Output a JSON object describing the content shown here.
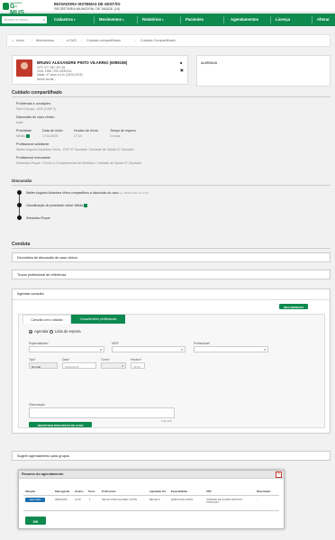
{
  "header": {
    "logo_small": "Inovadora",
    "logo_text": "G-MUS",
    "org_name": "INOVADORA SISTEMAS DE GESTÃO",
    "org_sub": "SECRETARIA MUNICIPAL DE SAÚDE (10)"
  },
  "nav": {
    "search_placeholder": "Buscar no menu...",
    "items": [
      "Cadastros",
      "Movimentos",
      "Relatórios",
      "Pacientes",
      "Agendamentos",
      "Licença",
      "Alterar"
    ]
  },
  "breadcrumb": [
    "Início",
    "Movimentos",
    "e-SUS",
    "Cuidado compartilhado",
    "Cuidado Compartilhado"
  ],
  "patient": {
    "name": "BRUNO ALEXANDRE PINTO VILARINO (6098186)",
    "lines": [
      "CPF: 077.987.207-51",
      "CNS: 1395 7031 0539 611",
      "Idade: 47 anos e 6 m (20/01/1978)",
      "Nome social: -"
    ],
    "alerts_label": "ALERGIAS"
  },
  "cuidado": {
    "title": "Cuidado compartilhado",
    "problem_label": "Problemas e condições",
    "problem_value": "Sem Doença - AH1 (CIAP 2)",
    "discussion_label": "Discussão de caso clínico",
    "discussion_value": "teste",
    "priority_label": "Prioridade",
    "priority_value": "Média",
    "start_date_label": "Data de início",
    "start_date_value": "17/11/2025",
    "start_time_label": "Horário de início",
    "start_time_value": "17:44",
    "wait_label": "Tempo de espera",
    "wait_value": "0 horas",
    "requester_label": "Profissional solicitante",
    "requester_value": "Walter Augusto Alcantara Vieira - ESF 07 Saudade / Unidade de Saúde 07 Saudade",
    "executor_label": "Profissional executante",
    "executor_value": "Sebastiao Roque / Clínico e Complementar de Medicina / Unidade de Saúde 07 Saudade"
  },
  "discussao": {
    "title": "Discussão",
    "entry1_text": "Walter Augusto Alcantara Vieira compartilhou a discussão do caso",
    "entry1_date": "em 08/06/2025 às 10:51",
    "entry2_text": "Classificação de prioridade inicial: Média",
    "entry3_text": "Sebastiao Roque"
  },
  "conduta": {
    "title": "Conduta",
    "option1": "Devolutiva de discussão de caso clínico",
    "option2": "Trocar profissional de referência",
    "agendar_title": "Agendar consulta",
    "add_button": "INCLUIR/NOVO",
    "tab1": "Consulta com o cidadão",
    "tab2": "Consulta entre profissionais",
    "radio_agendar": "Agendar",
    "radio_lista": "Lista de espera",
    "especialidade_label": "Especialidade",
    "ubs_label": "UBS",
    "profissional_label": "Profissional",
    "tipo_label": "Tipo",
    "tipo_value": "Normal",
    "data_label": "Data",
    "data_value": "05/06/2025",
    "turno_label": "Turno",
    "horario_label": "Horário",
    "horario_value": "08:00",
    "obs_label": "Observação",
    "obs_counter": "0 de 200",
    "register_button": "REGISTRAR DISCUSSÃO DE CASO",
    "sugerir": "Sugerir agendamento para grupos"
  },
  "modal": {
    "title": "Resumo do agendamento",
    "close": "×",
    "headers": [
      "Situação",
      "Data agenda",
      "Horário",
      "Turno",
      "Profissional",
      "Agendado Por",
      "Especialidade",
      "UPS",
      "Observação"
    ],
    "row": {
      "status": "Agendado",
      "date": "08/06/2025",
      "time": "12:00",
      "turno": "T",
      "professional": "SELCE VANIA HAUSEN COSTE",
      "by": "BELGEVI",
      "especialidade": "ENDOLOGIA 25003",
      "ups": "UNIDADE DE SAÚDE CENTRAL / CONSULTA",
      "obs": "-"
    },
    "ok": "OK"
  }
}
